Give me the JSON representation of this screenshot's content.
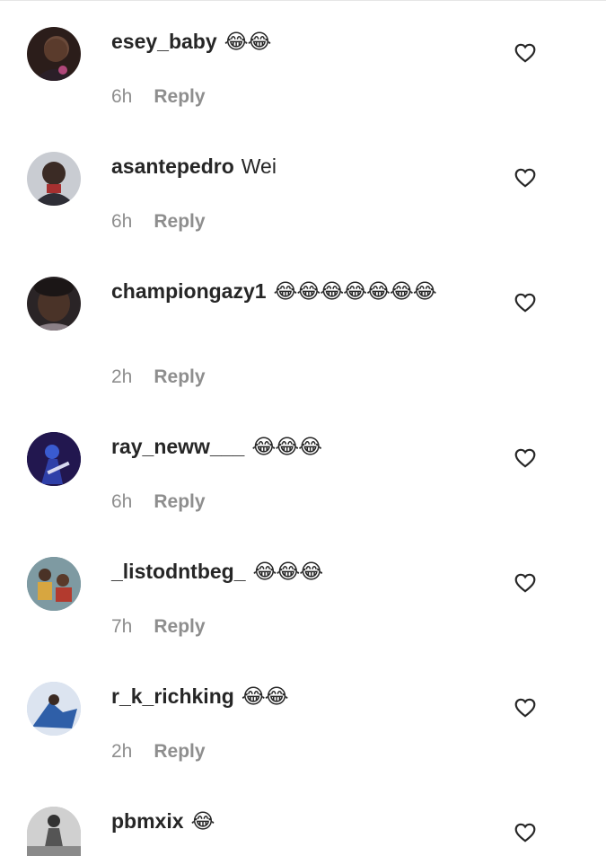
{
  "comments": [
    {
      "username": "esey_baby",
      "text": "😂😂",
      "time": "6h",
      "reply": "Reply"
    },
    {
      "username": "asantepedro",
      "text": "Wei",
      "time": "6h",
      "reply": "Reply"
    },
    {
      "username": "championgazy1",
      "text": "😂😂😂😂😂😂😂",
      "time": "2h",
      "reply": "Reply"
    },
    {
      "username": "ray_neww___",
      "text": "😂😂😂",
      "time": "6h",
      "reply": "Reply"
    },
    {
      "username": "_listodntbeg_",
      "text": "😂😂😂",
      "time": "7h",
      "reply": "Reply"
    },
    {
      "username": "r_k_richking",
      "text": "😂😂",
      "time": "2h",
      "reply": "Reply"
    },
    {
      "username": "pbmxix",
      "text": "😂"
    }
  ],
  "icons": {
    "like": "heart-outline-icon"
  }
}
